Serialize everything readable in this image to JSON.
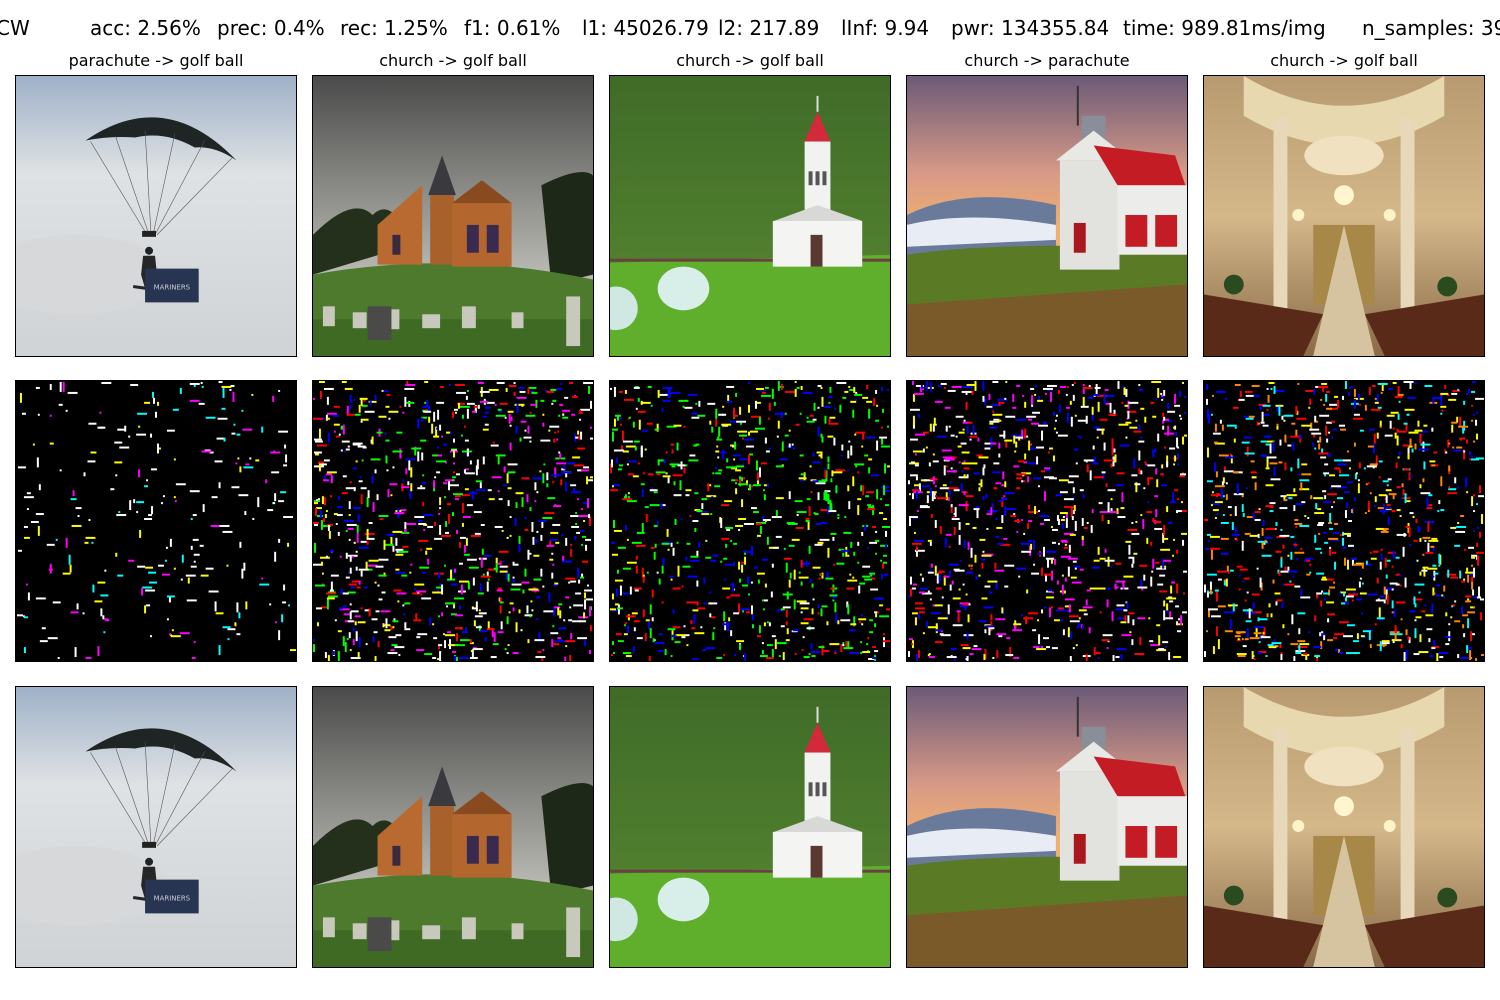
{
  "header": {
    "method": "CW",
    "acc": "acc: 2.56%",
    "prec": "prec: 0.4%",
    "rec": "rec: 1.25%",
    "f1": "f1: 0.61%",
    "l1": "l1: 45026.79",
    "l2": "l2: 217.89",
    "linf": "lInf: 9.94",
    "pwr": "pwr: 134355.84",
    "time": "time: 989.81ms/img",
    "n_samples": "n_samples: 39"
  },
  "columns": [
    {
      "title": "parachute -> golf ball",
      "scene": "parachute"
    },
    {
      "title": "church -> golf ball",
      "scene": "stone-church"
    },
    {
      "title": "church -> golf ball",
      "scene": "white-chapel"
    },
    {
      "title": "church -> parachute",
      "scene": "red-roof-church"
    },
    {
      "title": "church -> golf ball",
      "scene": "cathedral-interior"
    }
  ],
  "rows": [
    "original",
    "perturbation",
    "adversarial"
  ],
  "colors": {
    "sky": "#cfd6dc",
    "grass": "#4e8a2a",
    "roof_red": "#c8202a",
    "perturb_bg": "#000000"
  }
}
